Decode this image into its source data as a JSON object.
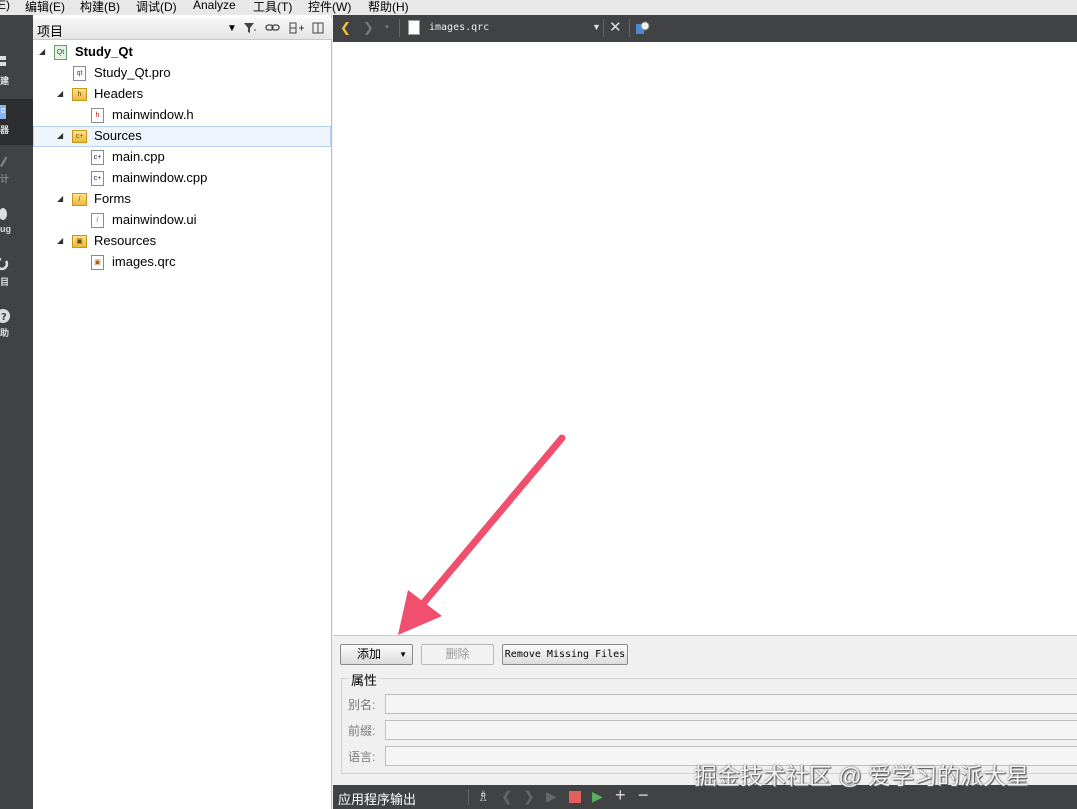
{
  "menubar": {
    "items": [
      "编辑(E)",
      "构建(B)",
      "调试(D)",
      "Analyze",
      "工具(T)",
      "控件(W)",
      "帮助(H)"
    ]
  },
  "modebar": {
    "items": [
      {
        "label": "建",
        "icon": "welcome-icon"
      },
      {
        "label": "器",
        "icon": "editor-icon"
      },
      {
        "label": "计",
        "icon": "design-icon"
      },
      {
        "label": "ug",
        "icon": "debug-icon"
      },
      {
        "label": "目",
        "icon": "projects-icon"
      },
      {
        "label": "助",
        "icon": "help-icon"
      }
    ]
  },
  "project_pane": {
    "title": "项目",
    "tree": [
      {
        "label": "Study_Qt",
        "type": "project",
        "depth": 0,
        "expanded": true
      },
      {
        "label": "Study_Qt.pro",
        "type": "pro-file",
        "depth": 1
      },
      {
        "label": "Headers",
        "type": "folder",
        "depth": 1,
        "expanded": true
      },
      {
        "label": "mainwindow.h",
        "type": "h-file",
        "depth": 2
      },
      {
        "label": "Sources",
        "type": "folder",
        "depth": 1,
        "expanded": true,
        "selected": true
      },
      {
        "label": "main.cpp",
        "type": "cpp-file",
        "depth": 2
      },
      {
        "label": "mainwindow.cpp",
        "type": "cpp-file",
        "depth": 2
      },
      {
        "label": "Forms",
        "type": "folder",
        "depth": 1,
        "expanded": true
      },
      {
        "label": "mainwindow.ui",
        "type": "ui-file",
        "depth": 2
      },
      {
        "label": "Resources",
        "type": "folder",
        "depth": 1,
        "expanded": true
      },
      {
        "label": "images.qrc",
        "type": "qrc-file",
        "depth": 2
      }
    ]
  },
  "editor_toolbar": {
    "document": "images.qrc"
  },
  "resource_panel": {
    "add_label": "添加",
    "remove_label": "删除",
    "remove_missing_label": "Remove Missing Files",
    "properties_title": "属性",
    "alias_label": "别名:",
    "prefix_label": "前缀:",
    "language_label": "语言:"
  },
  "output_bar": {
    "label": "应用程序输出"
  },
  "watermark": "掘金技术社区 @ 爱学习的派大星",
  "colors": {
    "dark_panel": "#404244",
    "annotation_arrow": "#f0506e",
    "selection": "#eef5fd"
  }
}
